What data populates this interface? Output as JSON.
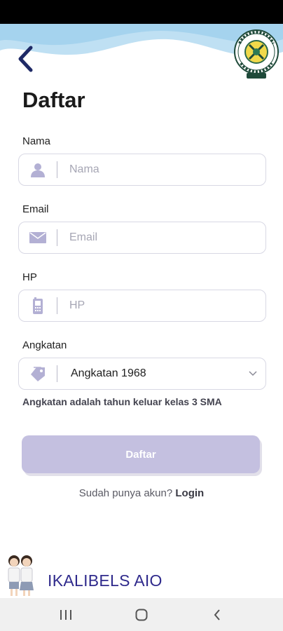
{
  "page": {
    "title": "Daftar"
  },
  "logo": {
    "text_top": "IKALIBELS",
    "text_bottom": "JAKARTA"
  },
  "form": {
    "nama": {
      "label": "Nama",
      "placeholder": "Nama",
      "icon": "person-icon"
    },
    "email": {
      "label": "Email",
      "placeholder": "Email",
      "icon": "envelope-icon"
    },
    "hp": {
      "label": "HP",
      "placeholder": "HP",
      "icon": "phone-icon"
    },
    "angkatan": {
      "label": "Angkatan",
      "selected": "Angkatan 1968",
      "icon": "tag-icon",
      "helper": "Angkatan adalah tahun keluar kelas 3 SMA"
    },
    "submit_label": "Daftar"
  },
  "login_prompt": {
    "text": "Sudah punya akun?",
    "link": "Login"
  },
  "brand": {
    "name": "IKALIBELS AIO"
  },
  "colors": {
    "accent": "#2f2a8c",
    "button": "#c4c0e0",
    "icon": "#b3b0d4"
  }
}
